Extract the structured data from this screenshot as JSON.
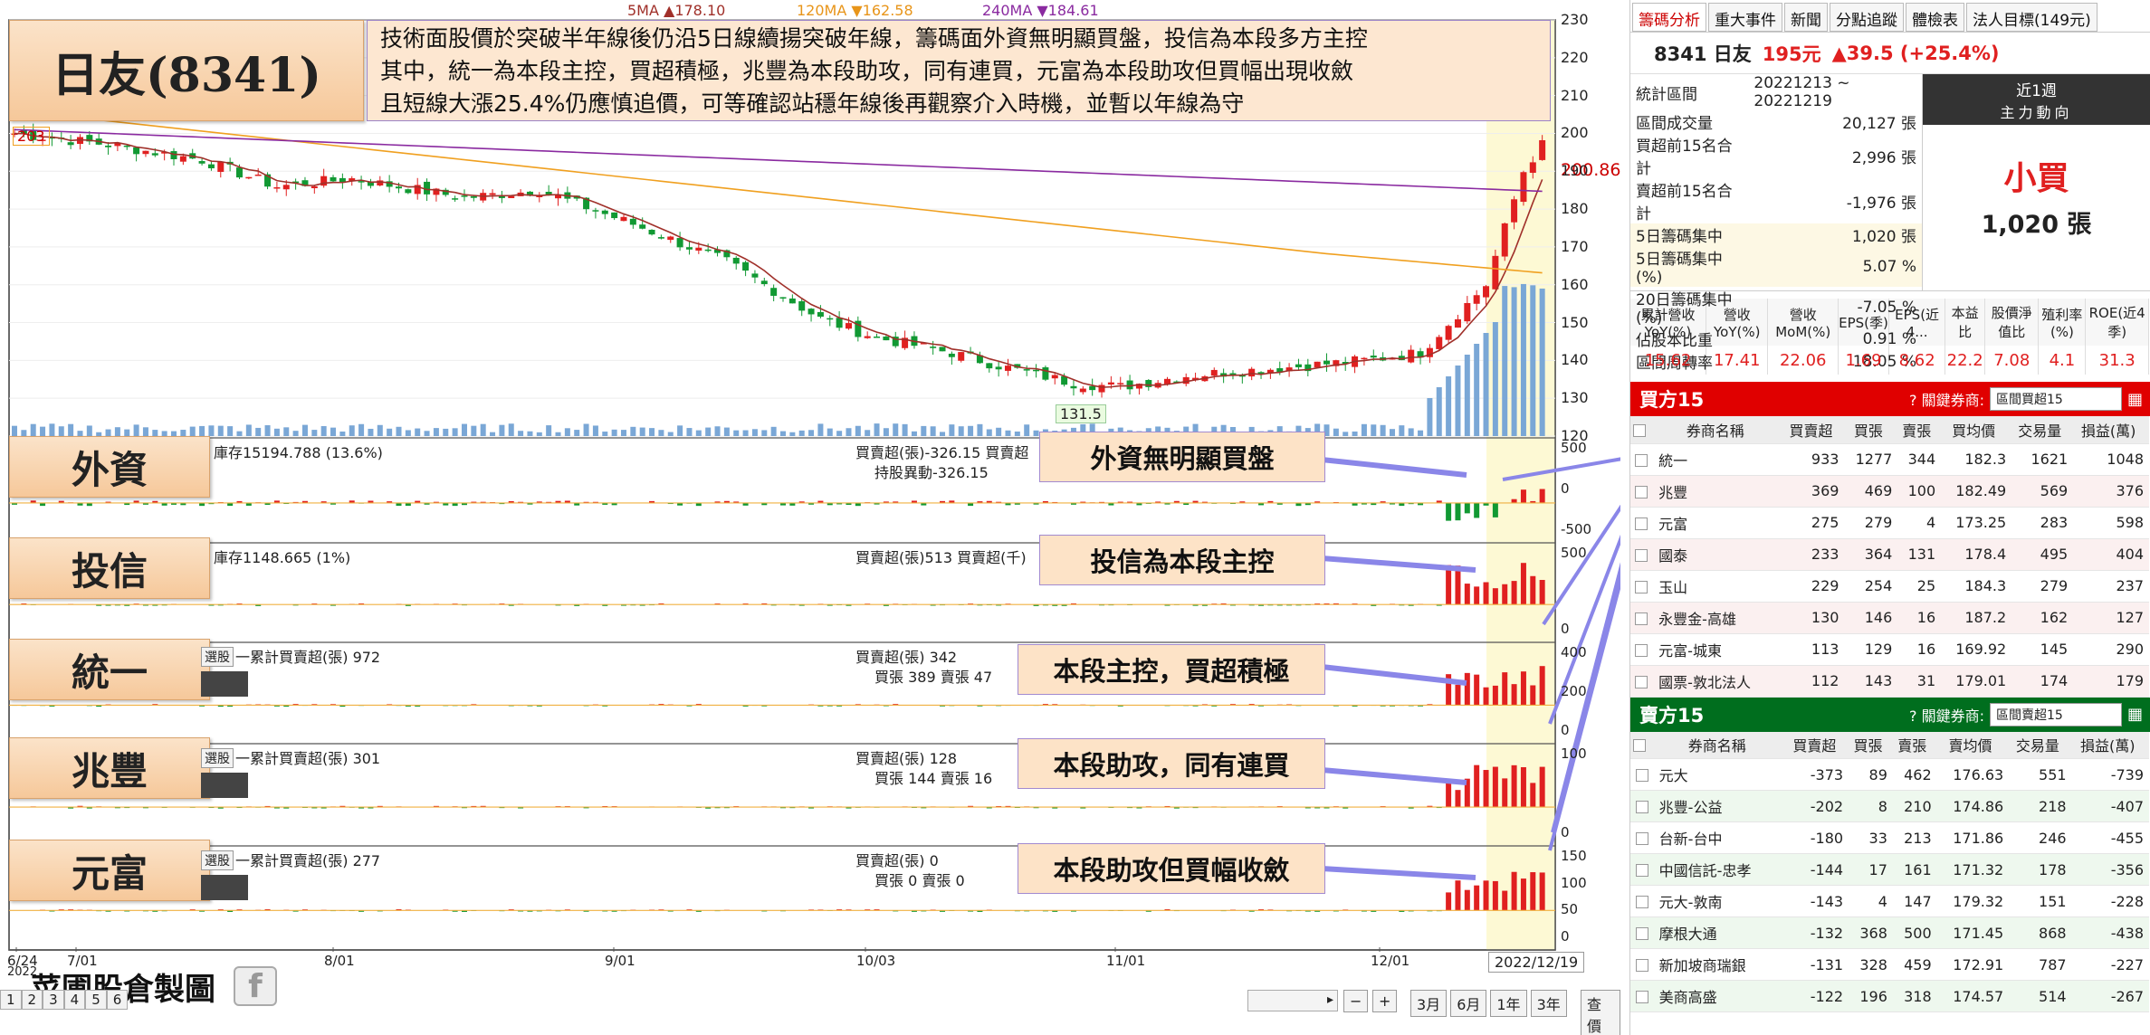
{
  "title": "日友(8341)",
  "commentary": "技術面股價於突破半年線後仍沿5日線續揚突破年線，籌碼面外資無明顯買盤，投信為本段多方主控\n其中，統一為本段主控，買超積極，兆豐為本段助攻，同有連買，元富為本段助攻但買幅出現收斂\n且短線大漲25.4%仍應慎追價，可等確認站穩年線後再觀察介入時機，並暫以年線為守",
  "ma_legend": {
    "ma5": "5MA ▲178.10",
    "ma120": "120MA ▼162.58",
    "ma240": "240MA ▼184.61"
  },
  "price_marks": {
    "top": "203",
    "last": "200.86",
    "low": "131.5"
  },
  "y_ticks": [
    "230",
    "220",
    "210",
    "200",
    "190",
    "180",
    "170",
    "160",
    "150",
    "140",
    "130",
    "120"
  ],
  "x_ticks": [
    "6/24",
    "7/01",
    "8/01",
    "9/01",
    "10/03",
    "11/01",
    "12/01"
  ],
  "x_year": "2022",
  "date_box": "2022/12/19",
  "panels": [
    {
      "label": "外資",
      "info1": "庫存15194.788 (13.6%)",
      "info2": "買賣超(張)-326.15 買賣超",
      "info3": "持股異動-326.15",
      "callout": "外資無明顯買盤",
      "ticks": [
        "500",
        "0",
        "-500"
      ]
    },
    {
      "label": "投信",
      "info1": "庫存1148.665 (1%)",
      "info2": "買賣超(張)513 買賣超(千)",
      "info3": "",
      "callout": "投信為本段主控",
      "ticks": [
        "500",
        "0"
      ]
    },
    {
      "label": "統一",
      "info1": "一累計買賣超(張) 972",
      "info2": "買賣超(張) 342",
      "info3": "買張 389 賣張 47",
      "callout": "本段主控，買超積極",
      "ticks": [
        "400",
        "200",
        "0"
      ]
    },
    {
      "label": "兆豐",
      "info1": "一累計買賣超(張) 301",
      "info2": "買賣超(張) 128",
      "info3": "買張 144 賣張 16",
      "callout": "本段助攻，同有連買",
      "ticks": [
        "100",
        "0"
      ]
    },
    {
      "label": "元富",
      "info1": "一累計買賣超(張) 277",
      "info2": "買賣超(張) 0",
      "info3": "買張 0 賣張 0",
      "callout": "本段助攻但買幅收斂",
      "ticks": [
        "150",
        "100",
        "50",
        "0"
      ]
    }
  ],
  "watermark": "菜圃股倉製圖",
  "bottom": {
    "pages": [
      "1",
      "2",
      "3",
      "4",
      "5",
      "6"
    ],
    "periods": [
      "3月",
      "6月",
      "1年",
      "3年"
    ],
    "query": "查價",
    "zoom_out": "−",
    "zoom_in": "+",
    "select": "選股"
  },
  "tabs": [
    "籌碼分析",
    "重大事件",
    "新聞",
    "分點追蹤",
    "體檢表",
    "法人目標(149元)"
  ],
  "quote": {
    "code": "8341 日友",
    "price": "195元",
    "change": "▲39.5 (+25.4%)"
  },
  "stats": [
    {
      "k": "統計區間",
      "v": "20221213 ~ 20221219"
    },
    {
      "k": "區間成交量",
      "v": "20,127 張"
    },
    {
      "k": "買超前15名合計",
      "v": "2,996 張"
    },
    {
      "k": "賣超前15名合計",
      "v": "-1,976 張"
    },
    {
      "k": "5日籌碼集中",
      "v": "1,020 張"
    },
    {
      "k": "5日籌碼集中(%)",
      "v": "5.07 %"
    },
    {
      "k": "20日籌碼集中(%)",
      "v": "-7.05 %"
    },
    {
      "k": "佔股本比重",
      "v": "0.91 %"
    },
    {
      "k": "區間周轉率",
      "v": "18.05 %"
    }
  ],
  "main_force": {
    "period": "近1週",
    "label": "主力動向",
    "signal": "小買",
    "amount": "1,020 張"
  },
  "fin_headers": [
    "累計營收YoY(%)",
    "營收YoY(%)",
    "營收MoM(%)",
    "EPS(季)",
    "EPS(近4...",
    "本益比",
    "股價淨值比",
    "殖利率(%)",
    "ROE(近4季)"
  ],
  "fin_values": [
    "15.62",
    "17.41",
    "22.06",
    "1.69",
    "8.62",
    "22.2",
    "7.08",
    "4.1",
    "31.3"
  ],
  "buy": {
    "title": "買方15",
    "filter_label": "關鍵券商:",
    "filter": "區間買超15",
    "cols": [
      "券商名稱",
      "買賣超",
      "買張",
      "賣張",
      "買均價",
      "交易量",
      "損益(萬)"
    ],
    "rows": [
      [
        "統一",
        "933",
        "1277",
        "344",
        "182.3",
        "1621",
        "1048"
      ],
      [
        "兆豐",
        "369",
        "469",
        "100",
        "182.49",
        "569",
        "376"
      ],
      [
        "元富",
        "275",
        "279",
        "4",
        "173.25",
        "283",
        "598"
      ],
      [
        "國泰",
        "233",
        "364",
        "131",
        "178.4",
        "495",
        "404"
      ],
      [
        "玉山",
        "229",
        "254",
        "25",
        "184.3",
        "279",
        "237"
      ],
      [
        "永豐金-高雄",
        "130",
        "146",
        "16",
        "187.2",
        "162",
        "127"
      ],
      [
        "元富-城東",
        "113",
        "129",
        "16",
        "169.92",
        "145",
        "290"
      ],
      [
        "國票-敦北法人",
        "112",
        "143",
        "31",
        "179.01",
        "174",
        "179"
      ]
    ]
  },
  "sell": {
    "title": "賣方15",
    "filter_label": "關鍵券商:",
    "filter": "區間賣超15",
    "cols": [
      "券商名稱",
      "買賣超",
      "買張",
      "賣張",
      "賣均價",
      "交易量",
      "損益(萬)"
    ],
    "rows": [
      [
        "元大",
        "-373",
        "89",
        "462",
        "176.63",
        "551",
        "-739"
      ],
      [
        "兆豐-公益",
        "-202",
        "8",
        "210",
        "174.86",
        "218",
        "-407"
      ],
      [
        "台新-台中",
        "-180",
        "33",
        "213",
        "171.86",
        "246",
        "-455"
      ],
      [
        "中國信託-忠孝",
        "-144",
        "17",
        "161",
        "171.32",
        "178",
        "-356"
      ],
      [
        "元大-敦南",
        "-143",
        "4",
        "147",
        "179.32",
        "151",
        "-228"
      ],
      [
        "摩根大通",
        "-132",
        "368",
        "500",
        "171.45",
        "868",
        "-438"
      ],
      [
        "新加坡商瑞銀",
        "-131",
        "328",
        "459",
        "172.91",
        "787",
        "-227"
      ],
      [
        "美商高盛",
        "-122",
        "196",
        "318",
        "174.57",
        "514",
        "-267"
      ]
    ]
  },
  "colors": {
    "up": "#e02020",
    "down": "#119933",
    "ma5": "#a0302a",
    "ma120": "#f0a020",
    "ma240": "#8a2aa0",
    "vol": "#7aa7d6"
  }
}
